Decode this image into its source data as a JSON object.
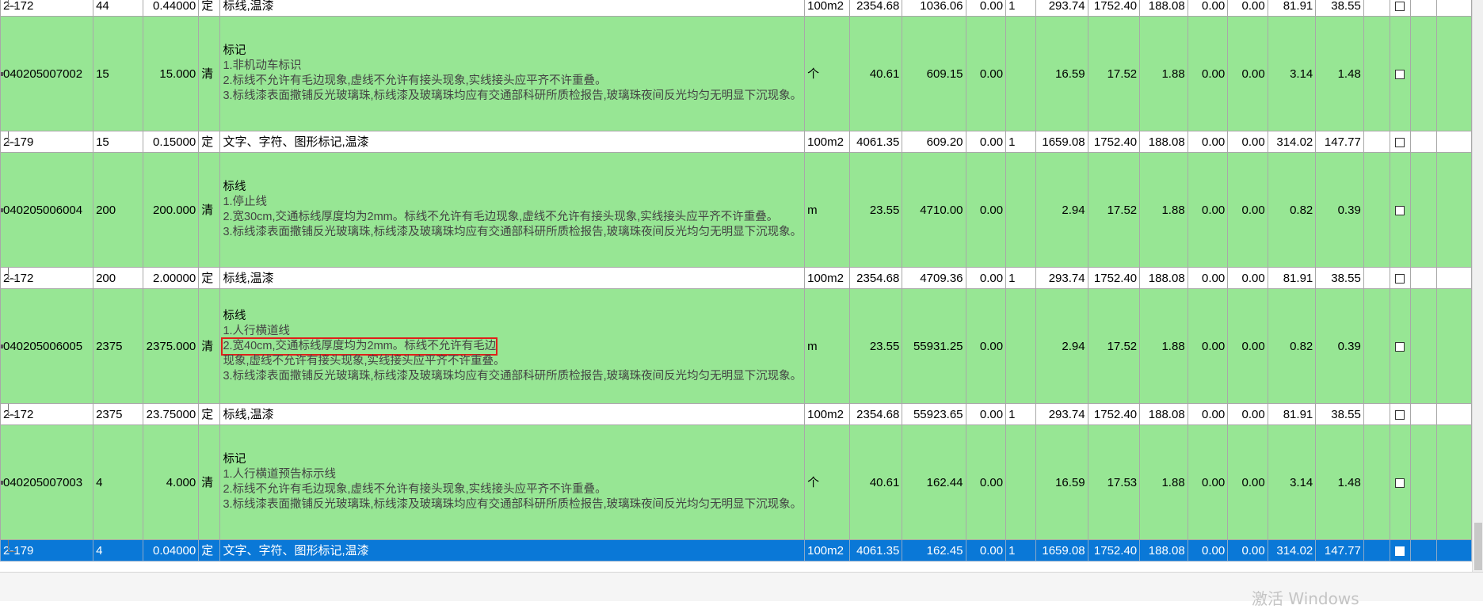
{
  "rows": [
    {
      "type": "child",
      "code": "2-172",
      "qty": "44",
      "amount": "0.44000",
      "kind": "定",
      "desc": "标线,温漆",
      "unit": "100m2",
      "price": "2354.68",
      "total": "1036.06",
      "c1": "0.00",
      "c2": "1",
      "c3": "293.74",
      "c4": "1752.40",
      "c5": "188.08",
      "c6": "0.00",
      "c7": "0.00",
      "c8": "81.91",
      "c9": "38.55"
    },
    {
      "type": "parent",
      "code": "040205007002",
      "qty": "15",
      "amount": "15.000",
      "kind": "清",
      "title": "标记",
      "lines": [
        "1.非机动车标识",
        "2.标线不允许有毛边现象,虚线不允许有接头现象,实线接头应平齐不许重叠。",
        "3.标线漆表面撒铺反光玻璃珠,标线漆及玻璃珠均应有交通部科研所质检报告,玻璃珠夜间反光均匀无明显下沉现象。"
      ],
      "unit": "个",
      "price": "40.61",
      "total": "609.15",
      "c1": "0.00",
      "c2": "",
      "c3": "16.59",
      "c4": "17.52",
      "c5": "1.88",
      "c6": "0.00",
      "c7": "0.00",
      "c8": "3.14",
      "c9": "1.48"
    },
    {
      "type": "child",
      "code": "2-179",
      "qty": "15",
      "amount": "0.15000",
      "kind": "定",
      "desc": "文字、字符、图形标记,温漆",
      "unit": "100m2",
      "price": "4061.35",
      "total": "609.20",
      "c1": "0.00",
      "c2": "1",
      "c3": "1659.08",
      "c4": "1752.40",
      "c5": "188.08",
      "c6": "0.00",
      "c7": "0.00",
      "c8": "314.02",
      "c9": "147.77"
    },
    {
      "type": "parent",
      "code": "040205006004",
      "qty": "200",
      "amount": "200.000",
      "kind": "清",
      "title": "标线",
      "lines": [
        "1.停止线",
        "2.宽30cm,交通标线厚度均为2mm。标线不允许有毛边现象,虚线不允许有接头现象,实线接头应平齐不许重叠。",
        "3.标线漆表面撒铺反光玻璃珠,标线漆及玻璃珠均应有交通部科研所质检报告,玻璃珠夜间反光均匀无明显下沉现象。"
      ],
      "unit": "m",
      "price": "23.55",
      "total": "4710.00",
      "c1": "0.00",
      "c2": "",
      "c3": "2.94",
      "c4": "17.52",
      "c5": "1.88",
      "c6": "0.00",
      "c7": "0.00",
      "c8": "0.82",
      "c9": "0.39"
    },
    {
      "type": "child",
      "code": "2-172",
      "qty": "200",
      "amount": "2.00000",
      "kind": "定",
      "desc": "标线,温漆",
      "unit": "100m2",
      "price": "2354.68",
      "total": "4709.36",
      "c1": "0.00",
      "c2": "1",
      "c3": "293.74",
      "c4": "1752.40",
      "c5": "188.08",
      "c6": "0.00",
      "c7": "0.00",
      "c8": "81.91",
      "c9": "38.55"
    },
    {
      "type": "parent",
      "code": "040205006005",
      "qty": "2375",
      "amount": "2375.000",
      "kind": "清",
      "title": "标线",
      "lines": [
        "1.人行横道线",
        "2.宽40cm,交通标线厚度均为2mm。标线不允许有毛边",
        "现象,虚线不允许有接头现象,实线接头应平齐不许重叠。",
        "3.标线漆表面撒铺反光玻璃珠,标线漆及玻璃珠均应有交通部科研所质检报告,玻璃珠夜间反光均匀无明显下沉现象。"
      ],
      "highlight_line": 1,
      "unit": "m",
      "price": "23.55",
      "total": "55931.25",
      "c1": "0.00",
      "c2": "",
      "c3": "2.94",
      "c4": "17.52",
      "c5": "1.88",
      "c6": "0.00",
      "c7": "0.00",
      "c8": "0.82",
      "c9": "0.39"
    },
    {
      "type": "child",
      "code": "2-172",
      "qty": "2375",
      "amount": "23.75000",
      "kind": "定",
      "desc": "标线,温漆",
      "unit": "100m2",
      "price": "2354.68",
      "total": "55923.65",
      "c1": "0.00",
      "c2": "1",
      "c3": "293.74",
      "c4": "1752.40",
      "c5": "188.08",
      "c6": "0.00",
      "c7": "0.00",
      "c8": "81.91",
      "c9": "38.55"
    },
    {
      "type": "parent",
      "code": "040205007003",
      "qty": "4",
      "amount": "4.000",
      "kind": "清",
      "title": "标记",
      "lines": [
        "1.人行横道预告标示线",
        "2.标线不允许有毛边现象,虚线不允许有接头现象,实线接头应平齐不许重叠。",
        "3.标线漆表面撒铺反光玻璃珠,标线漆及玻璃珠均应有交通部科研所质检报告,玻璃珠夜间反光均匀无明显下沉现象。"
      ],
      "unit": "个",
      "price": "40.61",
      "total": "162.44",
      "c1": "0.00",
      "c2": "",
      "c3": "16.59",
      "c4": "17.53",
      "c5": "1.88",
      "c6": "0.00",
      "c7": "0.00",
      "c8": "3.14",
      "c9": "1.48"
    },
    {
      "type": "child",
      "selected": true,
      "code": "2-179",
      "qty": "4",
      "amount": "0.04000",
      "kind": "定",
      "desc": "文字、字符、图形标记,温漆",
      "unit": "100m2",
      "price": "4061.35",
      "total": "162.45",
      "c1": "0.00",
      "c2": "1",
      "c3": "1659.08",
      "c4": "1752.40",
      "c5": "188.08",
      "c6": "0.00",
      "c7": "0.00",
      "c8": "314.02",
      "c9": "147.77"
    }
  ],
  "watermark": "激活 Windows"
}
